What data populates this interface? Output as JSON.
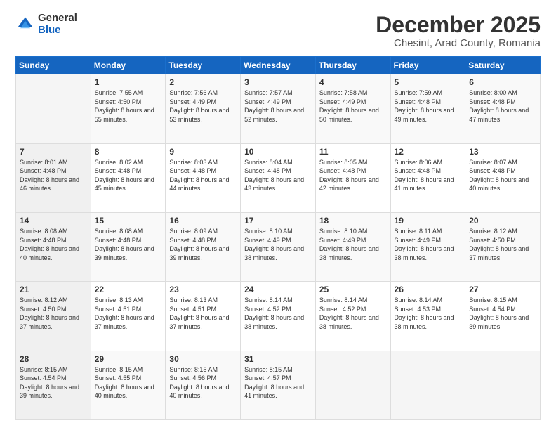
{
  "logo": {
    "general": "General",
    "blue": "Blue"
  },
  "header": {
    "title": "December 2025",
    "subtitle": "Chesint, Arad County, Romania"
  },
  "weekdays": [
    "Sunday",
    "Monday",
    "Tuesday",
    "Wednesday",
    "Thursday",
    "Friday",
    "Saturday"
  ],
  "weeks": [
    [
      {
        "day": "",
        "sunrise": "",
        "sunset": "",
        "daylight": ""
      },
      {
        "day": "1",
        "sunrise": "Sunrise: 7:55 AM",
        "sunset": "Sunset: 4:50 PM",
        "daylight": "Daylight: 8 hours and 55 minutes."
      },
      {
        "day": "2",
        "sunrise": "Sunrise: 7:56 AM",
        "sunset": "Sunset: 4:49 PM",
        "daylight": "Daylight: 8 hours and 53 minutes."
      },
      {
        "day": "3",
        "sunrise": "Sunrise: 7:57 AM",
        "sunset": "Sunset: 4:49 PM",
        "daylight": "Daylight: 8 hours and 52 minutes."
      },
      {
        "day": "4",
        "sunrise": "Sunrise: 7:58 AM",
        "sunset": "Sunset: 4:49 PM",
        "daylight": "Daylight: 8 hours and 50 minutes."
      },
      {
        "day": "5",
        "sunrise": "Sunrise: 7:59 AM",
        "sunset": "Sunset: 4:48 PM",
        "daylight": "Daylight: 8 hours and 49 minutes."
      },
      {
        "day": "6",
        "sunrise": "Sunrise: 8:00 AM",
        "sunset": "Sunset: 4:48 PM",
        "daylight": "Daylight: 8 hours and 47 minutes."
      }
    ],
    [
      {
        "day": "7",
        "sunrise": "Sunrise: 8:01 AM",
        "sunset": "Sunset: 4:48 PM",
        "daylight": "Daylight: 8 hours and 46 minutes."
      },
      {
        "day": "8",
        "sunrise": "Sunrise: 8:02 AM",
        "sunset": "Sunset: 4:48 PM",
        "daylight": "Daylight: 8 hours and 45 minutes."
      },
      {
        "day": "9",
        "sunrise": "Sunrise: 8:03 AM",
        "sunset": "Sunset: 4:48 PM",
        "daylight": "Daylight: 8 hours and 44 minutes."
      },
      {
        "day": "10",
        "sunrise": "Sunrise: 8:04 AM",
        "sunset": "Sunset: 4:48 PM",
        "daylight": "Daylight: 8 hours and 43 minutes."
      },
      {
        "day": "11",
        "sunrise": "Sunrise: 8:05 AM",
        "sunset": "Sunset: 4:48 PM",
        "daylight": "Daylight: 8 hours and 42 minutes."
      },
      {
        "day": "12",
        "sunrise": "Sunrise: 8:06 AM",
        "sunset": "Sunset: 4:48 PM",
        "daylight": "Daylight: 8 hours and 41 minutes."
      },
      {
        "day": "13",
        "sunrise": "Sunrise: 8:07 AM",
        "sunset": "Sunset: 4:48 PM",
        "daylight": "Daylight: 8 hours and 40 minutes."
      }
    ],
    [
      {
        "day": "14",
        "sunrise": "Sunrise: 8:08 AM",
        "sunset": "Sunset: 4:48 PM",
        "daylight": "Daylight: 8 hours and 40 minutes."
      },
      {
        "day": "15",
        "sunrise": "Sunrise: 8:08 AM",
        "sunset": "Sunset: 4:48 PM",
        "daylight": "Daylight: 8 hours and 39 minutes."
      },
      {
        "day": "16",
        "sunrise": "Sunrise: 8:09 AM",
        "sunset": "Sunset: 4:48 PM",
        "daylight": "Daylight: 8 hours and 39 minutes."
      },
      {
        "day": "17",
        "sunrise": "Sunrise: 8:10 AM",
        "sunset": "Sunset: 4:49 PM",
        "daylight": "Daylight: 8 hours and 38 minutes."
      },
      {
        "day": "18",
        "sunrise": "Sunrise: 8:10 AM",
        "sunset": "Sunset: 4:49 PM",
        "daylight": "Daylight: 8 hours and 38 minutes."
      },
      {
        "day": "19",
        "sunrise": "Sunrise: 8:11 AM",
        "sunset": "Sunset: 4:49 PM",
        "daylight": "Daylight: 8 hours and 38 minutes."
      },
      {
        "day": "20",
        "sunrise": "Sunrise: 8:12 AM",
        "sunset": "Sunset: 4:50 PM",
        "daylight": "Daylight: 8 hours and 37 minutes."
      }
    ],
    [
      {
        "day": "21",
        "sunrise": "Sunrise: 8:12 AM",
        "sunset": "Sunset: 4:50 PM",
        "daylight": "Daylight: 8 hours and 37 minutes."
      },
      {
        "day": "22",
        "sunrise": "Sunrise: 8:13 AM",
        "sunset": "Sunset: 4:51 PM",
        "daylight": "Daylight: 8 hours and 37 minutes."
      },
      {
        "day": "23",
        "sunrise": "Sunrise: 8:13 AM",
        "sunset": "Sunset: 4:51 PM",
        "daylight": "Daylight: 8 hours and 37 minutes."
      },
      {
        "day": "24",
        "sunrise": "Sunrise: 8:14 AM",
        "sunset": "Sunset: 4:52 PM",
        "daylight": "Daylight: 8 hours and 38 minutes."
      },
      {
        "day": "25",
        "sunrise": "Sunrise: 8:14 AM",
        "sunset": "Sunset: 4:52 PM",
        "daylight": "Daylight: 8 hours and 38 minutes."
      },
      {
        "day": "26",
        "sunrise": "Sunrise: 8:14 AM",
        "sunset": "Sunset: 4:53 PM",
        "daylight": "Daylight: 8 hours and 38 minutes."
      },
      {
        "day": "27",
        "sunrise": "Sunrise: 8:15 AM",
        "sunset": "Sunset: 4:54 PM",
        "daylight": "Daylight: 8 hours and 39 minutes."
      }
    ],
    [
      {
        "day": "28",
        "sunrise": "Sunrise: 8:15 AM",
        "sunset": "Sunset: 4:54 PM",
        "daylight": "Daylight: 8 hours and 39 minutes."
      },
      {
        "day": "29",
        "sunrise": "Sunrise: 8:15 AM",
        "sunset": "Sunset: 4:55 PM",
        "daylight": "Daylight: 8 hours and 40 minutes."
      },
      {
        "day": "30",
        "sunrise": "Sunrise: 8:15 AM",
        "sunset": "Sunset: 4:56 PM",
        "daylight": "Daylight: 8 hours and 40 minutes."
      },
      {
        "day": "31",
        "sunrise": "Sunrise: 8:15 AM",
        "sunset": "Sunset: 4:57 PM",
        "daylight": "Daylight: 8 hours and 41 minutes."
      },
      {
        "day": "",
        "sunrise": "",
        "sunset": "",
        "daylight": ""
      },
      {
        "day": "",
        "sunrise": "",
        "sunset": "",
        "daylight": ""
      },
      {
        "day": "",
        "sunrise": "",
        "sunset": "",
        "daylight": ""
      }
    ]
  ]
}
